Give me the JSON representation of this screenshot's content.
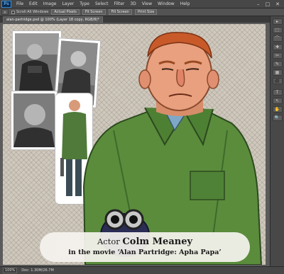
{
  "app": {
    "logo": "Ps"
  },
  "menu": [
    "File",
    "Edit",
    "Image",
    "Layer",
    "Type",
    "Select",
    "Filter",
    "3D",
    "View",
    "Window",
    "Help"
  ],
  "window_controls": {
    "minimize": "–",
    "maximize": "□",
    "close": "✕"
  },
  "options_bar": {
    "scroll_all_windows": "Scroll All Windows",
    "actual_pixels": "Actual Pixels",
    "fit_screen": "Fit Screen",
    "fill_screen": "Fill Screen",
    "print_size": "Print Size"
  },
  "document_tab": "alan-partridge.psd @ 100% (Layer 18 copy, RGB/8)*",
  "status": {
    "zoom": "100%",
    "doc_size": "Doc: 1.30M/26.7M"
  },
  "caption": {
    "prefix": "Actor",
    "name": "Colm Meaney",
    "subtitle": "in the movie ‘Alan Partridge: Apha Papa’"
  },
  "tools": [
    "▸",
    "⬚",
    "⌒",
    "✚",
    "✂",
    "✎",
    "▦",
    "⬛",
    "T",
    "↖",
    "✋",
    "🔍"
  ],
  "colors": {
    "jacket": "#5a8c3c",
    "skin": "#e8a07e",
    "hair": "#c85a2a",
    "glove": "#2b2d55",
    "canvas": "#cfc8bd"
  },
  "reference_photos": [
    "reference-photo-1",
    "reference-photo-2",
    "reference-photo-3",
    "reference-photo-4"
  ]
}
